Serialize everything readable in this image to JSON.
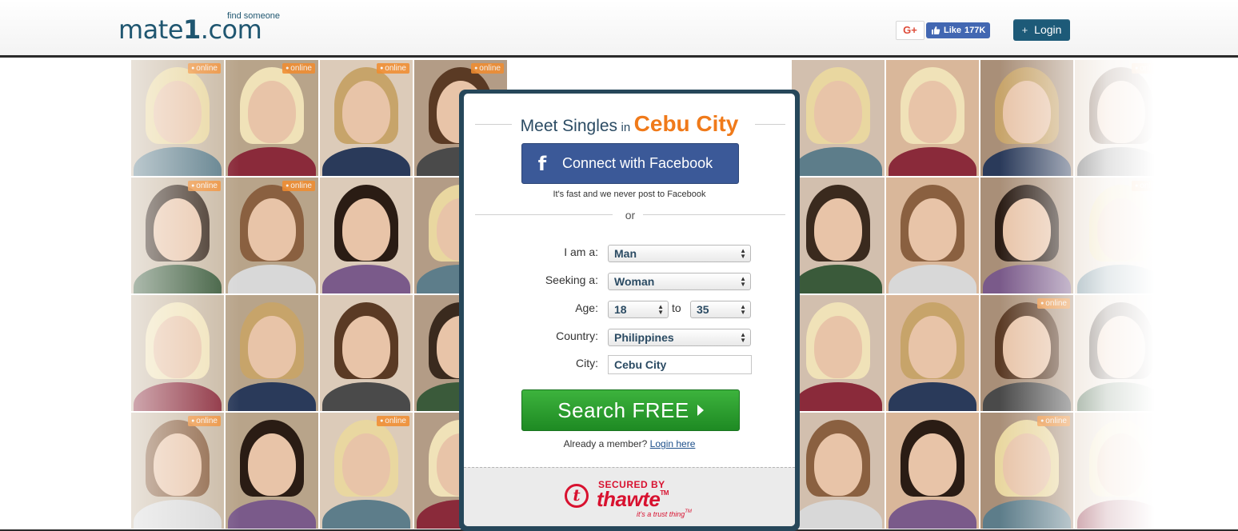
{
  "header": {
    "logo_text": "mate",
    "logo_one": "1",
    "logo_domain": ".com",
    "logo_tagline": "find someone",
    "gplus_label": "G+",
    "fb_like_label": "Like",
    "fb_like_count": "177K",
    "login_label": "Login"
  },
  "grid": {
    "online_label": "online"
  },
  "form": {
    "headline_pre": "Meet Singles",
    "headline_in": "in",
    "headline_city": "Cebu City",
    "facebook_button": "Connect with Facebook",
    "facebook_note": "It's fast and we never post to Facebook",
    "or_label": "or",
    "i_am_label": "I am a:",
    "i_am_value": "Man",
    "seeking_label": "Seeking a:",
    "seeking_value": "Woman",
    "age_label": "Age:",
    "age_from": "18",
    "age_to_label": "to",
    "age_to": "35",
    "country_label": "Country:",
    "country_value": "Philippines",
    "city_label": "City:",
    "city_value": "Cebu City",
    "search_button": "Search FREE",
    "member_text": "Already a member?",
    "member_link": "Login here"
  },
  "secure": {
    "secured_by": "SECURED BY",
    "brand": "thawte",
    "tm": "TM",
    "tagline": "it's a trust thing",
    "tagline_tm": "TM"
  },
  "colors": {
    "brand": "#1f5670",
    "accent_orange": "#f07a1a",
    "facebook_blue": "#3b5998",
    "search_green": "#1e8a23",
    "panel_frame": "#26475a",
    "thawte_red": "#d8112f"
  }
}
